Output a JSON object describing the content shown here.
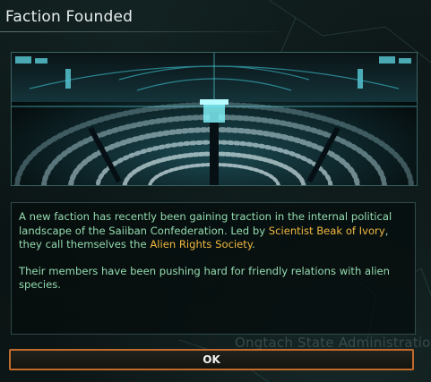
{
  "window": {
    "title": "Faction Founded"
  },
  "background": {
    "label": "Ongtach State Administration"
  },
  "event": {
    "p1_a": "A new faction has recently been gaining traction in the internal political landscape of the Saiiban Confederation. Led by ",
    "p1_leader": "Scientist Beak of Ivory",
    "p1_b": ", they call themselves the ",
    "p1_faction": "Alien Rights Society",
    "p1_c": ".",
    "p2": "Their members have been pushing hard for friendly relations with alien species."
  },
  "buttons": {
    "ok": "OK"
  },
  "colors": {
    "text": "#94dcb0",
    "highlight": "#f0b840",
    "button_border": "#c26b2a"
  }
}
